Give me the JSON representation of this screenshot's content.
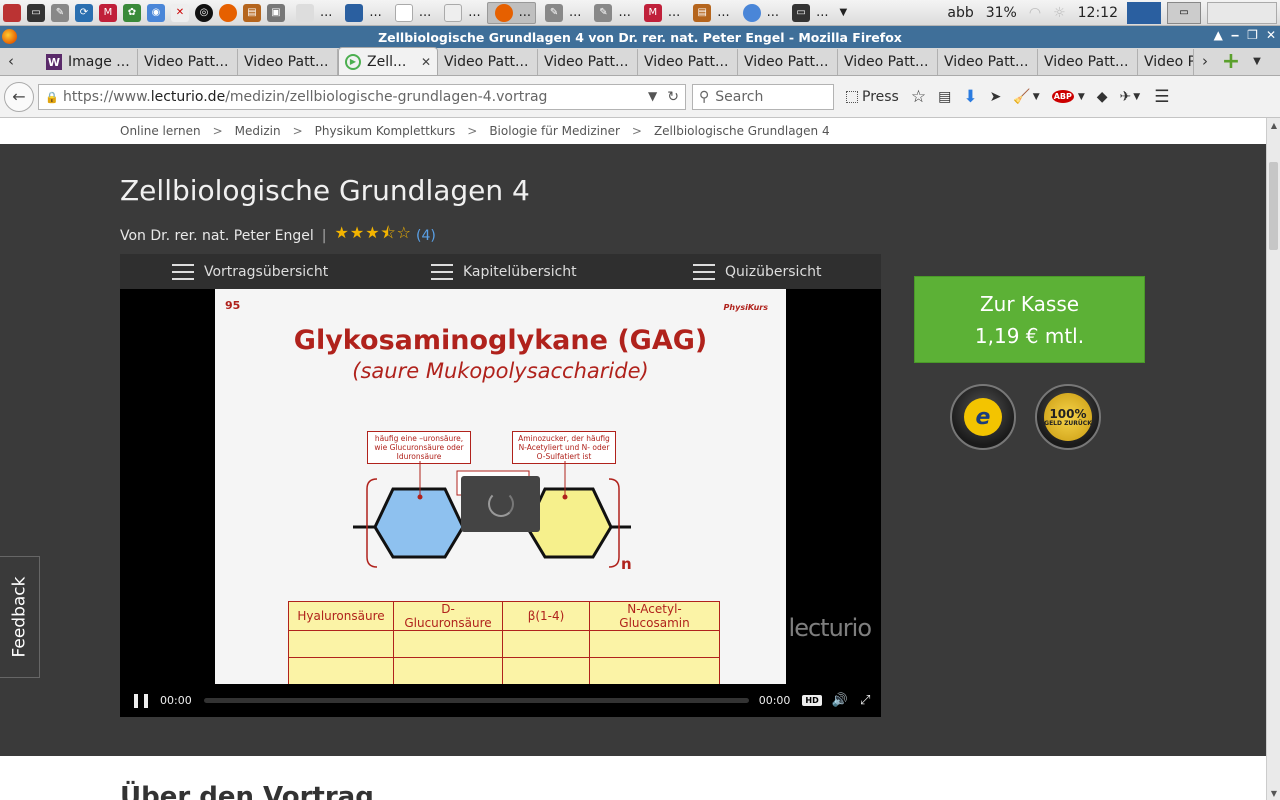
{
  "taskbar": {
    "tasks": [
      {
        "icon": "firefox-icon",
        "label": "..."
      },
      {
        "icon": "notepad-icon",
        "label": "..."
      },
      {
        "icon": "document-icon",
        "label": "..."
      },
      {
        "icon": "document-icon",
        "label": "..."
      },
      {
        "icon": "firefox-icon",
        "label": "..."
      },
      {
        "icon": "editor-icon",
        "label": "..."
      },
      {
        "icon": "editor-icon",
        "label": "..."
      },
      {
        "icon": "mail-icon",
        "label": "..."
      },
      {
        "icon": "archive-icon",
        "label": "..."
      },
      {
        "icon": "chrome-icon",
        "label": "..."
      },
      {
        "icon": "terminal-icon",
        "label": "..."
      }
    ],
    "keyboard": "abb",
    "battery": "31%",
    "clock": "12:12"
  },
  "window": {
    "title": "Zellbiologische Grundlagen 4 von Dr. rer. nat. Peter Engel - Mozilla Firefox"
  },
  "tabs": [
    {
      "label": "Image ...",
      "icon": "W"
    },
    {
      "label": "Video Patt...",
      "icon": ""
    },
    {
      "label": "Video Patt...",
      "icon": ""
    },
    {
      "label": "Zell...",
      "icon": "play",
      "active": true,
      "close": "✕"
    },
    {
      "label": "Video Patt...",
      "icon": ""
    },
    {
      "label": "Video Patt...",
      "icon": ""
    },
    {
      "label": "Video Patt...",
      "icon": ""
    },
    {
      "label": "Video Patt...",
      "icon": ""
    },
    {
      "label": "Video Patt...",
      "icon": ""
    },
    {
      "label": "Video Patt...",
      "icon": ""
    },
    {
      "label": "Video Patt...",
      "icon": ""
    },
    {
      "label": "Video P",
      "icon": ""
    }
  ],
  "navbar": {
    "url_prefix": "https://www.",
    "url_domain": "lecturio.de",
    "url_path": "/medizin/zellbiologische-grundlagen-4.vortrag",
    "search_placeholder": "Search",
    "press_label": "Press"
  },
  "breadcrumb": [
    "Online lernen",
    "Medizin",
    "Physikum Komplettkurs",
    "Biologie für Mediziner",
    "Zellbiologische Grundlagen 4"
  ],
  "lecture": {
    "title": "Zellbiologische Grundlagen 4",
    "author": "Von Dr. rer. nat. Peter Engel",
    "stars": "★★★⯪☆",
    "rating_count": "(4)"
  },
  "player": {
    "menu": [
      "Vortragsübersicht",
      "Kapitelübersicht",
      "Quizübersicht"
    ],
    "slide": {
      "number": "95",
      "brand": "PhysiKurs",
      "title": "Glykosaminoglykane (GAG)",
      "subtitle": "(saure Mukopolysaccharide)",
      "note_left": "häufig eine –uronsäure, wie Glucuronsäure oder Iduronsäure",
      "note_right": "Aminozucker, der häufig N-Acetyliert und N- oder O-Sulfatiert ist",
      "repeat_label": "n",
      "table_row": [
        "Hyaluronsäure",
        "D-Glucuronsäure",
        "β(1-4)",
        "N-Acetyl-Glucosamin"
      ]
    },
    "watermark": "lecturio",
    "time_current": "00:00",
    "time_total": "00:00",
    "hd_label": "HD"
  },
  "purchase": {
    "line1": "Zur Kasse",
    "line2": "1,19 € mtl.",
    "badge1": "e",
    "badge2_top": "100%",
    "badge2_bottom": "GELD ZURÜCK"
  },
  "section_heading": "Über den Vortrag",
  "feedback_label": "Feedback",
  "colors": {
    "hero_bg": "#3a3a3a",
    "checkout_green": "#5cb136",
    "slide_red": "#b0221c",
    "rating_star": "#f3b400",
    "titlebar_blue": "#3f6f99"
  }
}
